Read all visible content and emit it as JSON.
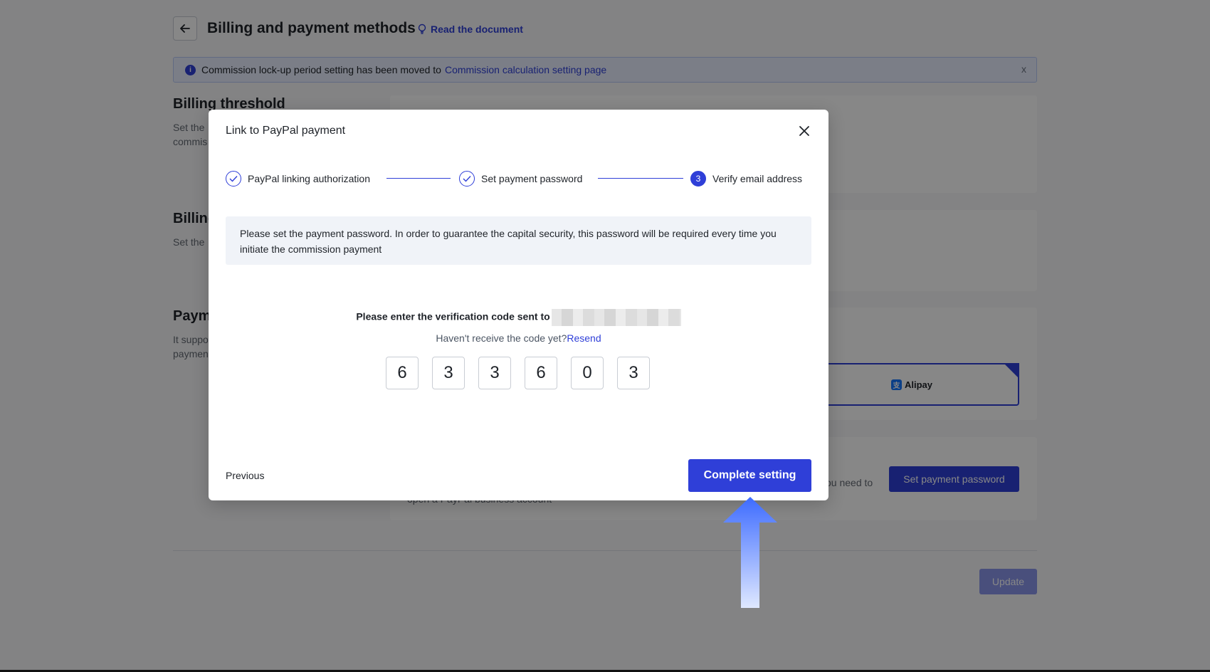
{
  "header": {
    "title": "Billing and payment methods",
    "doc_link": "Read the document"
  },
  "notice": {
    "text": "Commission lock-up period setting has been moved to",
    "link": "Commission calculation setting page",
    "close": "x"
  },
  "sections": {
    "threshold_title": "Billing threshold",
    "threshold_desc": "Set the\ncommis",
    "billing_title": "Billing",
    "billing_desc": "Set the",
    "payment_title": "Paym",
    "payment_desc": "It suppo\npaymen"
  },
  "payment_methods": {
    "alipay_label": "Alipay",
    "need_text": "ou need to",
    "set_password_button": "Set payment password",
    "paypal_hint": "open a PayPal business account"
  },
  "footer": {
    "update_button": "Update"
  },
  "modal": {
    "title": "Link to PayPal payment",
    "steps": [
      {
        "label": "PayPal linking authorization",
        "status": "done"
      },
      {
        "label": "Set payment password",
        "status": "done"
      },
      {
        "label": "Verify email address",
        "status": "active",
        "number": "3"
      }
    ],
    "tip": "Please set the payment password. In order to guarantee the capital security, this password will be required every time you initiate the commission payment",
    "verify_prompt": "Please enter the verification code sent to",
    "resend_prompt": "Haven't receive the code yet?",
    "resend_link": "Resend",
    "code_digits": [
      "6",
      "3",
      "3",
      "6",
      "0",
      "3"
    ],
    "previous_button": "Previous",
    "complete_button": "Complete setting"
  },
  "colors": {
    "accent": "#2f3fd8",
    "arrow": "#4a7bff"
  },
  "icons": {
    "back": "arrow-left-icon",
    "doc": "bulb-icon",
    "info": "info-icon",
    "close": "close-icon",
    "check": "check-icon",
    "arrow": "arrow-up-icon"
  }
}
